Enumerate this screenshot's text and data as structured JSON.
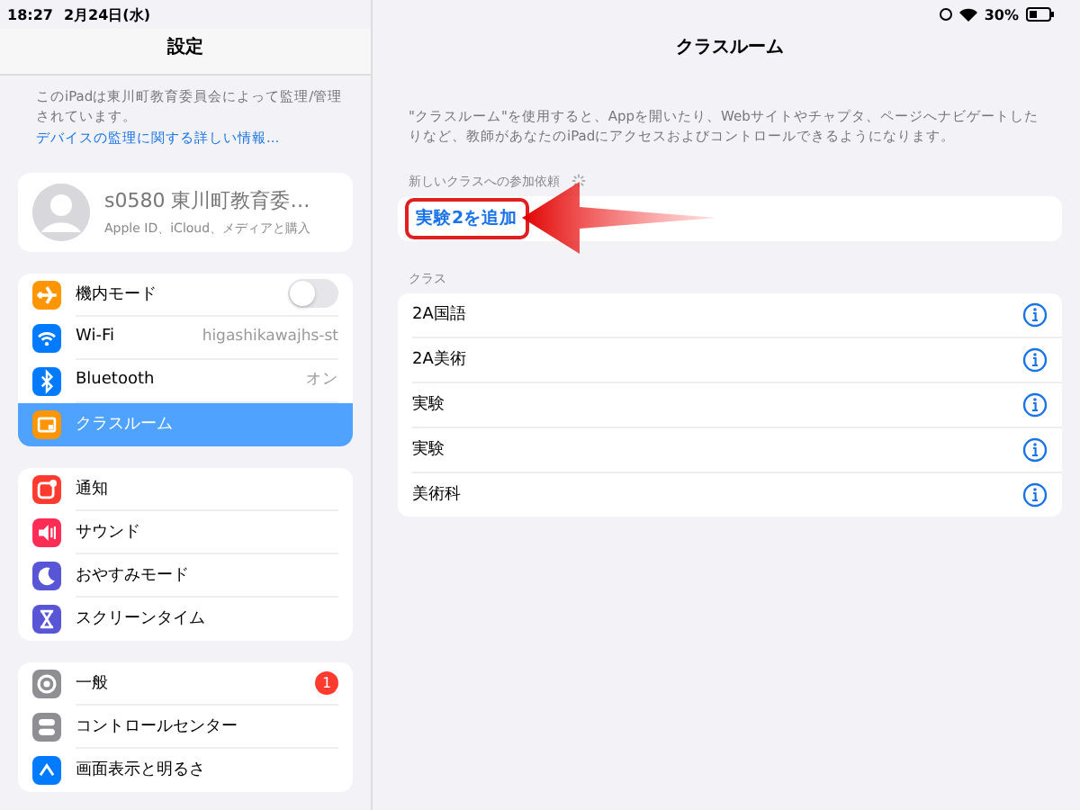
{
  "status_bar": {
    "time": "18:27",
    "date": "2月24日(水)",
    "battery": "30%"
  },
  "sidebar": {
    "title": "設定",
    "notice": "このiPadは東川町教育委員会によって監理/管理されています。",
    "notice_link": "デバイスの監理に関する詳しい情報...",
    "profile": {
      "name": "s0580 東川町教育委…",
      "subtitle": "Apple ID、iCloud、メディアと購入"
    },
    "groups": [
      [
        {
          "label": "機内モード",
          "kind": "toggle",
          "on": false,
          "selected": false,
          "color": "#ff9500"
        },
        {
          "label": "Wi-Fi",
          "kind": "value",
          "value": "higashikawajhs-st",
          "selected": false,
          "color": "#007aff"
        },
        {
          "label": "Bluetooth",
          "kind": "value",
          "value": "オン",
          "selected": false,
          "color": "#007aff"
        },
        {
          "label": "クラスルーム",
          "kind": "plain",
          "selected": true,
          "color": "#ff9500"
        }
      ],
      [
        {
          "label": "通知",
          "kind": "plain",
          "selected": false,
          "color": "#ff3b30"
        },
        {
          "label": "サウンド",
          "kind": "plain",
          "selected": false,
          "color": "#ff2d55"
        },
        {
          "label": "おやすみモード",
          "kind": "plain",
          "selected": false,
          "color": "#5856d6"
        },
        {
          "label": "スクリーンタイム",
          "kind": "plain",
          "selected": false,
          "color": "#5856d6"
        }
      ],
      [
        {
          "label": "一般",
          "kind": "badge",
          "badge": "1",
          "selected": false,
          "color": "#8e8e93"
        },
        {
          "label": "コントロールセンター",
          "kind": "plain",
          "selected": false,
          "color": "#8e8e93"
        },
        {
          "label": "画面表示と明るさ",
          "kind": "plain",
          "selected": false,
          "color": "#007aff"
        }
      ]
    ]
  },
  "detail": {
    "title": "クラスルーム",
    "description": "\"クラスルーム\"を使用すると、Appを開いたり、Webサイトやチャプタ、ページへナビゲートしたりなど、教師があなたのiPadにアクセスおよびコントロールできるようになります。",
    "invite_header": "新しいクラスへの参加依頼",
    "invite_action": "実験2を追加",
    "classes_header": "クラス",
    "classes": [
      "2A国語",
      "2A美術",
      "実験",
      "実験",
      "美術科"
    ]
  }
}
